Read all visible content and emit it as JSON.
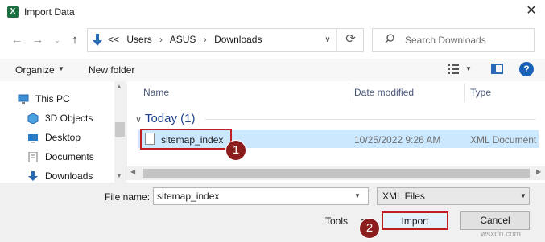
{
  "window": {
    "title": "Import Data",
    "app_icon_letter": "X"
  },
  "nav": {
    "breadcrumb": [
      "<<",
      "Users",
      "ASUS",
      "Downloads"
    ],
    "search_placeholder": "Search Downloads"
  },
  "toolbar": {
    "organize": "Organize",
    "new_folder": "New folder"
  },
  "sidebar": {
    "items": [
      {
        "label": "This PC",
        "icon": "computer-icon"
      },
      {
        "label": "3D Objects",
        "icon": "cube-icon"
      },
      {
        "label": "Desktop",
        "icon": "desktop-icon"
      },
      {
        "label": "Documents",
        "icon": "document-icon"
      },
      {
        "label": "Downloads",
        "icon": "download-icon"
      }
    ]
  },
  "file_list": {
    "columns": [
      "Name",
      "Date modified",
      "Type"
    ],
    "group": "Today (1)",
    "rows": [
      {
        "name": "sitemap_index",
        "date": "10/25/2022 9:26 AM",
        "type": "XML Document",
        "selected": true
      }
    ]
  },
  "footer": {
    "file_name_label": "File name:",
    "file_name_value": "sitemap_index",
    "file_type": "XML Files",
    "tools": "Tools",
    "import": "Import",
    "cancel": "Cancel"
  },
  "annotations": {
    "badge1": "1",
    "badge2": "2"
  },
  "watermark": "wsxdn.com",
  "colors": {
    "accent": "#1a62b8",
    "selection": "#cce8ff",
    "highlight": "#c21d20",
    "badge": "#8b1d1d"
  }
}
